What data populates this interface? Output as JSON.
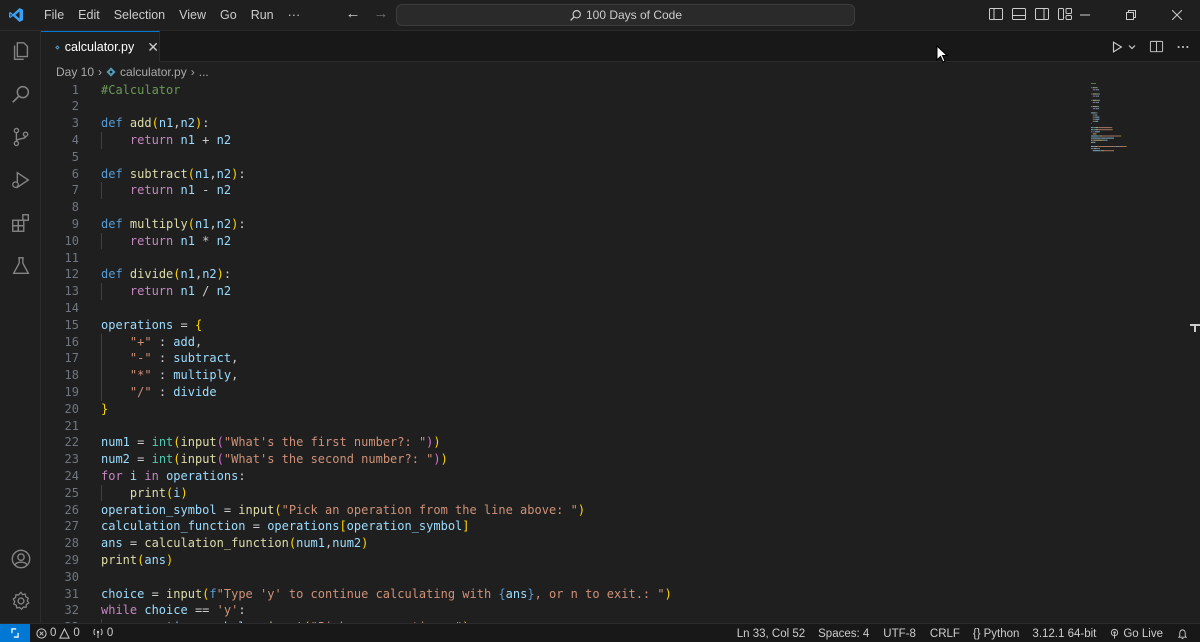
{
  "menu": [
    "File",
    "Edit",
    "Selection",
    "View",
    "Go",
    "Run",
    "···"
  ],
  "search": {
    "label": "100 Days of Code"
  },
  "tab": {
    "label": "calculator.py",
    "close": "✕"
  },
  "breadcrumb": {
    "folder": "Day 10",
    "file": "calculator.py",
    "more": "..."
  },
  "colors": {
    "keyword": "#569cd6",
    "control": "#c586c0",
    "function": "#dcdcaa",
    "variable": "#9cdcfe",
    "string": "#ce9178",
    "comment": "#6a9955",
    "bracket1": "#ffd700",
    "bracket2": "#da70d6",
    "bracket3": "#179fff",
    "builtin": "#4ec9b0",
    "accent": "#0078d4"
  },
  "code_lines": [
    [
      [
        "#Calculator",
        "comment"
      ]
    ],
    [],
    [
      [
        "def",
        "keyword"
      ],
      [
        " ",
        ""
      ],
      [
        "add",
        "function"
      ],
      [
        "(",
        "bracket1"
      ],
      [
        "n1",
        "variable"
      ],
      [
        ",",
        ""
      ],
      [
        "n2",
        "variable"
      ],
      [
        ")",
        "bracket1"
      ],
      [
        ":",
        ""
      ]
    ],
    [
      [
        "    ",
        ""
      ],
      [
        "return",
        "control"
      ],
      [
        " ",
        ""
      ],
      [
        "n1",
        "variable"
      ],
      [
        " + ",
        ""
      ],
      [
        "n2",
        "variable"
      ]
    ],
    [],
    [
      [
        "def",
        "keyword"
      ],
      [
        " ",
        ""
      ],
      [
        "subtract",
        "function"
      ],
      [
        "(",
        "bracket1"
      ],
      [
        "n1",
        "variable"
      ],
      [
        ",",
        ""
      ],
      [
        "n2",
        "variable"
      ],
      [
        ")",
        "bracket1"
      ],
      [
        ":",
        ""
      ]
    ],
    [
      [
        "    ",
        ""
      ],
      [
        "return",
        "control"
      ],
      [
        " ",
        ""
      ],
      [
        "n1",
        "variable"
      ],
      [
        " - ",
        ""
      ],
      [
        "n2",
        "variable"
      ]
    ],
    [],
    [
      [
        "def",
        "keyword"
      ],
      [
        " ",
        ""
      ],
      [
        "multiply",
        "function"
      ],
      [
        "(",
        "bracket1"
      ],
      [
        "n1",
        "variable"
      ],
      [
        ",",
        ""
      ],
      [
        "n2",
        "variable"
      ],
      [
        ")",
        "bracket1"
      ],
      [
        ":",
        ""
      ]
    ],
    [
      [
        "    ",
        ""
      ],
      [
        "return",
        "control"
      ],
      [
        " ",
        ""
      ],
      [
        "n1",
        "variable"
      ],
      [
        " * ",
        ""
      ],
      [
        "n2",
        "variable"
      ]
    ],
    [],
    [
      [
        "def",
        "keyword"
      ],
      [
        " ",
        ""
      ],
      [
        "divide",
        "function"
      ],
      [
        "(",
        "bracket1"
      ],
      [
        "n1",
        "variable"
      ],
      [
        ",",
        ""
      ],
      [
        "n2",
        "variable"
      ],
      [
        ")",
        "bracket1"
      ],
      [
        ":",
        ""
      ]
    ],
    [
      [
        "    ",
        ""
      ],
      [
        "return",
        "control"
      ],
      [
        " ",
        ""
      ],
      [
        "n1",
        "variable"
      ],
      [
        " / ",
        ""
      ],
      [
        "n2",
        "variable"
      ]
    ],
    [],
    [
      [
        "operations",
        "variable"
      ],
      [
        " = ",
        ""
      ],
      [
        "{",
        "bracket1"
      ]
    ],
    [
      [
        "    ",
        ""
      ],
      [
        "\"+\"",
        "string"
      ],
      [
        " : ",
        ""
      ],
      [
        "add",
        "variable"
      ],
      [
        ",",
        ""
      ]
    ],
    [
      [
        "    ",
        ""
      ],
      [
        "\"-\"",
        "string"
      ],
      [
        " : ",
        ""
      ],
      [
        "subtract",
        "variable"
      ],
      [
        ",",
        ""
      ]
    ],
    [
      [
        "    ",
        ""
      ],
      [
        "\"*\"",
        "string"
      ],
      [
        " : ",
        ""
      ],
      [
        "multiply",
        "variable"
      ],
      [
        ",",
        ""
      ]
    ],
    [
      [
        "    ",
        ""
      ],
      [
        "\"/\"",
        "string"
      ],
      [
        " : ",
        ""
      ],
      [
        "divide",
        "variable"
      ]
    ],
    [
      [
        "}",
        "bracket1"
      ]
    ],
    [],
    [
      [
        "num1",
        "variable"
      ],
      [
        " = ",
        ""
      ],
      [
        "int",
        "builtin"
      ],
      [
        "(",
        "bracket1"
      ],
      [
        "input",
        "function"
      ],
      [
        "(",
        "bracket2"
      ],
      [
        "\"What's the first number?: \"",
        "string"
      ],
      [
        ")",
        "bracket2"
      ],
      [
        ")",
        "bracket1"
      ]
    ],
    [
      [
        "num2",
        "variable"
      ],
      [
        " = ",
        ""
      ],
      [
        "int",
        "builtin"
      ],
      [
        "(",
        "bracket1"
      ],
      [
        "input",
        "function"
      ],
      [
        "(",
        "bracket2"
      ],
      [
        "\"What's the second number?: \"",
        "string"
      ],
      [
        ")",
        "bracket2"
      ],
      [
        ")",
        "bracket1"
      ]
    ],
    [
      [
        "for",
        "control"
      ],
      [
        " ",
        ""
      ],
      [
        "i",
        "variable"
      ],
      [
        " ",
        ""
      ],
      [
        "in",
        "control"
      ],
      [
        " ",
        ""
      ],
      [
        "operations",
        "variable"
      ],
      [
        ":",
        ""
      ]
    ],
    [
      [
        "    ",
        ""
      ],
      [
        "print",
        "function"
      ],
      [
        "(",
        "bracket1"
      ],
      [
        "i",
        "variable"
      ],
      [
        ")",
        "bracket1"
      ]
    ],
    [
      [
        "operation_symbol",
        "variable"
      ],
      [
        " = ",
        ""
      ],
      [
        "input",
        "function"
      ],
      [
        "(",
        "bracket1"
      ],
      [
        "\"Pick an operation from the line above: \"",
        "string"
      ],
      [
        ")",
        "bracket1"
      ]
    ],
    [
      [
        "calculation_function",
        "variable"
      ],
      [
        " = ",
        ""
      ],
      [
        "operations",
        "variable"
      ],
      [
        "[",
        "bracket1"
      ],
      [
        "operation_symbol",
        "variable"
      ],
      [
        "]",
        "bracket1"
      ]
    ],
    [
      [
        "ans",
        "variable"
      ],
      [
        " = ",
        ""
      ],
      [
        "calculation_function",
        "function"
      ],
      [
        "(",
        "bracket1"
      ],
      [
        "num1",
        "variable"
      ],
      [
        ",",
        ""
      ],
      [
        "num2",
        "variable"
      ],
      [
        ")",
        "bracket1"
      ]
    ],
    [
      [
        "print",
        "function"
      ],
      [
        "(",
        "bracket1"
      ],
      [
        "ans",
        "variable"
      ],
      [
        ")",
        "bracket1"
      ]
    ],
    [],
    [
      [
        "choice",
        "variable"
      ],
      [
        " = ",
        ""
      ],
      [
        "input",
        "function"
      ],
      [
        "(",
        "bracket1"
      ],
      [
        "f",
        "keyword"
      ],
      [
        "\"Type 'y' to continue calculating with ",
        "string"
      ],
      [
        "{",
        "keyword"
      ],
      [
        "ans",
        "variable"
      ],
      [
        "}",
        "keyword"
      ],
      [
        ", or n to exit.: \"",
        "string"
      ],
      [
        ")",
        "bracket1"
      ]
    ],
    [
      [
        "while",
        "control"
      ],
      [
        " ",
        ""
      ],
      [
        "choice",
        "variable"
      ],
      [
        " == ",
        ""
      ],
      [
        "'y'",
        "string"
      ],
      [
        ":",
        ""
      ]
    ],
    [
      [
        "    ",
        ""
      ],
      [
        "operation_symbol",
        "variable"
      ],
      [
        " = ",
        ""
      ],
      [
        "input",
        "function"
      ],
      [
        "(",
        "bracket1"
      ],
      [
        "\"Pick an operation: \"",
        "string"
      ],
      [
        ")",
        "bracket1"
      ]
    ]
  ],
  "status": {
    "errors": "0",
    "warnings": "0",
    "ports": "0",
    "position": "Ln 33, Col 52",
    "spaces": "Spaces: 4",
    "encoding": "UTF-8",
    "eol": "CRLF",
    "language": "Python",
    "interpreter": "3.12.1 64-bit",
    "golive": "Go Live"
  }
}
